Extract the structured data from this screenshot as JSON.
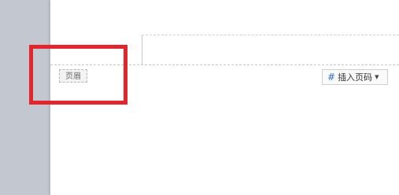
{
  "header": {
    "tag_label": "页眉"
  },
  "toolbar": {
    "insert_page_number_label": "插入页码",
    "insert_page_number_icon": "hash-icon",
    "dropdown_icon": "caret-down-icon"
  },
  "annotation": {
    "highlight_color": "#e3262d"
  }
}
